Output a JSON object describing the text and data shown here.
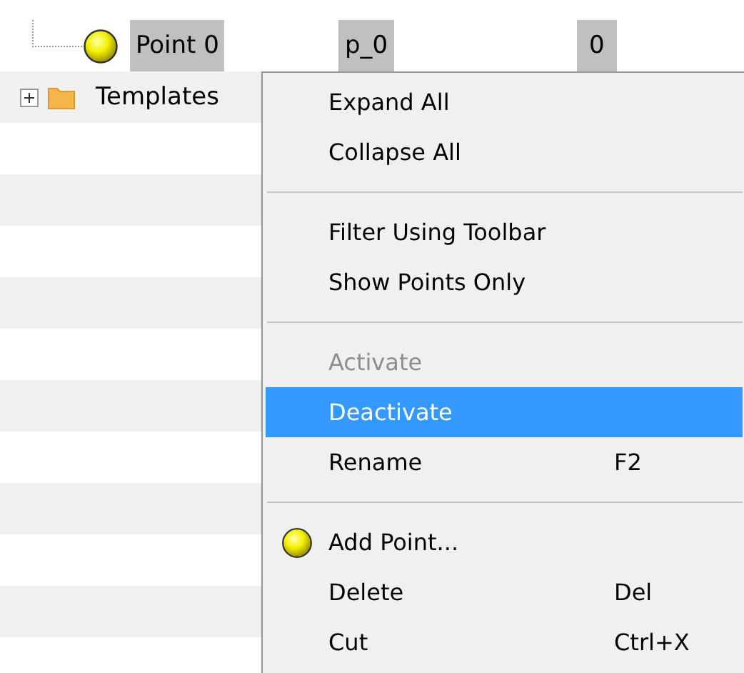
{
  "tree": {
    "rows": [
      {
        "kind": "point",
        "label": "Point 0",
        "column_2": "p_0",
        "column_3": "0",
        "selected": true
      },
      {
        "kind": "folder",
        "label": "Templates",
        "expanded": false,
        "selected": false
      }
    ]
  },
  "context_menu": {
    "items": [
      {
        "kind": "item",
        "label": "Expand All",
        "disabled": false,
        "selected": false
      },
      {
        "kind": "item",
        "label": "Collapse All",
        "disabled": false,
        "selected": false
      },
      {
        "kind": "separator"
      },
      {
        "kind": "item",
        "label": "Filter Using Toolbar",
        "disabled": false,
        "selected": false
      },
      {
        "kind": "item",
        "label": "Show Points Only",
        "disabled": false,
        "selected": false
      },
      {
        "kind": "separator"
      },
      {
        "kind": "item",
        "label": "Activate",
        "disabled": true,
        "selected": false
      },
      {
        "kind": "item",
        "label": "Deactivate",
        "disabled": false,
        "selected": true
      },
      {
        "kind": "item",
        "label": "Rename",
        "shortcut": "F2",
        "disabled": false,
        "selected": false
      },
      {
        "kind": "separator"
      },
      {
        "kind": "point_item",
        "label": "Add Point...",
        "disabled": false,
        "selected": false
      },
      {
        "kind": "item",
        "label": "Delete",
        "shortcut": "Del",
        "disabled": false,
        "selected": false
      },
      {
        "kind": "item",
        "label": "Cut",
        "shortcut": "Ctrl+X",
        "disabled": false,
        "selected": false
      }
    ]
  }
}
